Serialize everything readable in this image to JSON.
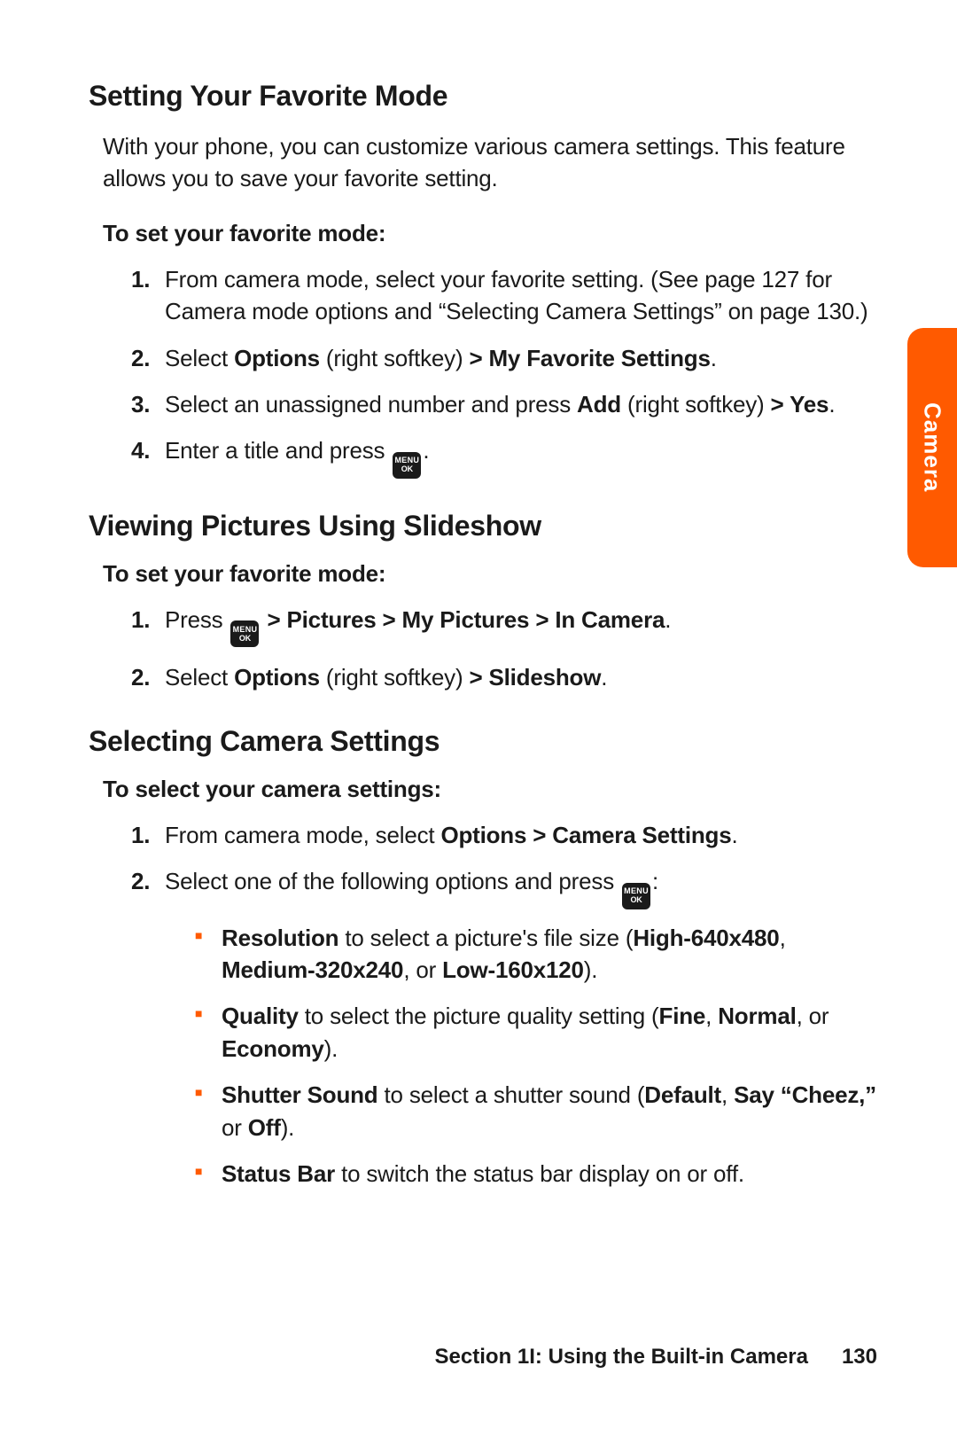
{
  "sideTab": "Camera",
  "footer": {
    "section": "Section 1I: Using the Built-in Camera",
    "page": "130"
  },
  "menuKey": {
    "line1": "MENU",
    "line2": "OK"
  },
  "h1": "Setting Your Favorite Mode",
  "intro1": "With your phone, you can customize various camera settings. This feature allows you to save your favorite setting.",
  "sub1": "To set your favorite mode:",
  "s1": {
    "i1": "From camera mode, select your favorite setting. (See page 127 for Camera mode options and “Selecting Camera Settings” on page 130.)",
    "i2a": "Select ",
    "i2b": "Options",
    "i2c": " (right softkey) ",
    "i2d": "> My Favorite Settings",
    "i2e": ".",
    "i3a": "Select an unassigned number and press ",
    "i3b": "Add",
    "i3c": " (right softkey) ",
    "i3d": "> Yes",
    "i3e": ".",
    "i4a": "Enter a title and press ",
    "i4b": "."
  },
  "h2": "Viewing Pictures Using Slideshow",
  "sub2": "To set your favorite mode:",
  "s2": {
    "i1a": "Press ",
    "i1b": " > Pictures > My Pictures > In Camera",
    "i1c": ".",
    "i2a": "Select ",
    "i2b": "Options",
    "i2c": " (right softkey) ",
    "i2d": "> Slideshow",
    "i2e": "."
  },
  "h3": "Selecting Camera Settings",
  "sub3": "To select your camera settings:",
  "s3": {
    "i1a": "From camera mode, select ",
    "i1b": "Options > Camera Settings",
    "i1c": ".",
    "i2a": "Select one of the following options and press ",
    "i2b": ":",
    "b1a": "Resolution",
    "b1b": " to select a picture's file size (",
    "b1c": "High-640x480",
    "b1d": ", ",
    "b1e": "Medium-320x240",
    "b1f": ", or ",
    "b1g": "Low-160x120",
    "b1h": ").",
    "b2a": "Quality",
    "b2b": " to select the picture quality setting (",
    "b2c": "Fine",
    "b2d": ", ",
    "b2e": "Normal",
    "b2f": ", or ",
    "b2g": "Economy",
    "b2h": ").",
    "b3a": "Shutter Sound",
    "b3b": " to select a shutter sound (",
    "b3c": "Default",
    "b3d": ", ",
    "b3e": "Say “Cheez,”",
    "b3f": " or ",
    "b3g": "Off",
    "b3h": ").",
    "b4a": "Status Bar",
    "b4b": " to switch the status bar display on or off."
  }
}
